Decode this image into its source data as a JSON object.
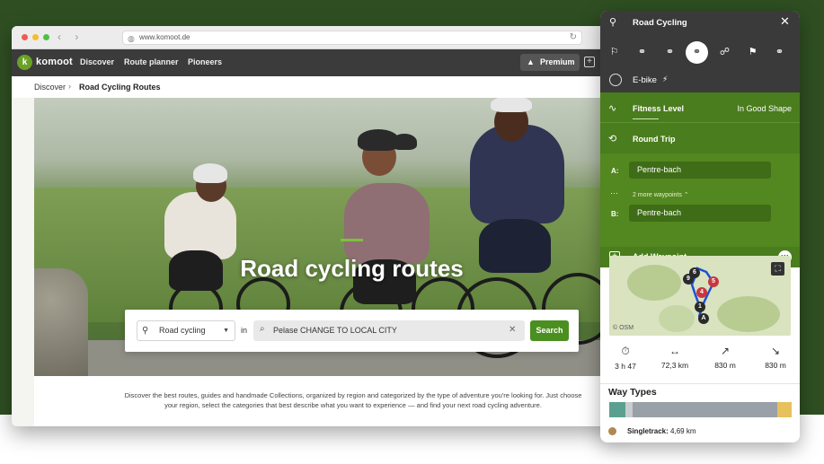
{
  "browser": {
    "url": "www.komoot.de"
  },
  "nav": {
    "logo_text": "komoot",
    "links": [
      "Discover",
      "Route planner",
      "Pioneers"
    ],
    "premium_label": "Premium"
  },
  "breadcrumb": {
    "parent": "Discover",
    "current": "Road Cycling Routes"
  },
  "hero": {
    "title": "Road cycling routes"
  },
  "search": {
    "sport_value": "Road cycling",
    "in_label": "in",
    "location_value": "Pelase CHANGE TO LOCAL CITY",
    "button_label": "Search"
  },
  "intro": {
    "text": "Discover the best routes, guides and handmade Collections, organized by region and categorized by the type of adventure you're looking for. Just choose your region, select the categories that best describe what you want to experience — and find your next road cycling adventure."
  },
  "panel": {
    "title": "Road Cycling",
    "sports": [
      "hiking-icon",
      "bike-icon",
      "mtb-icon",
      "road-bike-icon",
      "climbing-icon",
      "running-icon",
      "gravel-icon"
    ],
    "ebike_label": "E-bike",
    "fitness_label": "Fitness Level",
    "fitness_value": "In Good Shape",
    "round_trip_label": "Round Trip",
    "waypoint_a_label": "A:",
    "waypoint_a_value": "Pentre-bach",
    "more_waypoints": "2 more waypoints",
    "waypoint_b_label": "B:",
    "waypoint_b_value": "Pentre-bach",
    "add_waypoint_label": "Add Waypoint",
    "map_attribution": "© OSM",
    "map_markers": [
      "9",
      "6",
      "5",
      "4",
      "1",
      "A"
    ],
    "stats": {
      "duration": "3 h 47",
      "distance": "72,3 km",
      "uphill": "830 m",
      "downhill": "830 m"
    },
    "way_types_title": "Way Types",
    "way_type_item_name": "Singletrack:",
    "way_type_item_value": "4,69 km",
    "colors": {
      "accent_green": "#4a7d1d",
      "dark": "#3b3a3a",
      "route_blue": "#1f4fd6"
    }
  }
}
